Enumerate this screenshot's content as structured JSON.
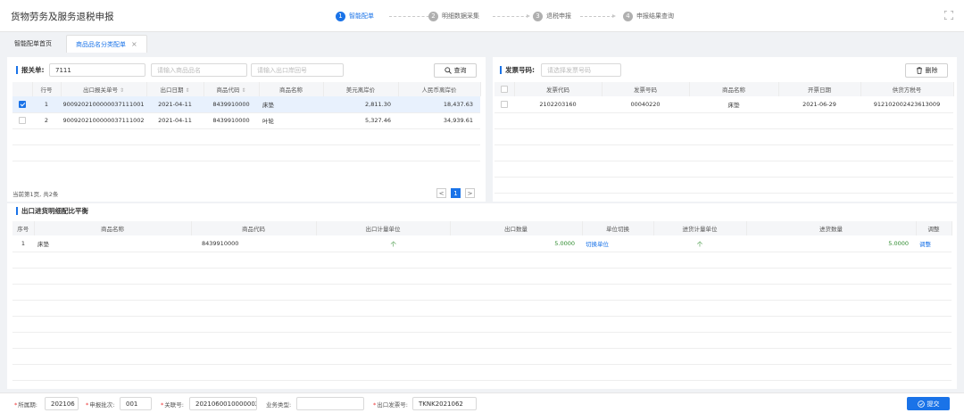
{
  "app": {
    "title": "货物劳务及服务退税申报"
  },
  "steps": [
    {
      "num": "1",
      "label": "智能配单"
    },
    {
      "num": "2",
      "label": "明细数据采集"
    },
    {
      "num": "3",
      "label": "退税申报"
    },
    {
      "num": "4",
      "label": "申报结果查询"
    }
  ],
  "tabs": {
    "home": "智能配单首页",
    "active": "商品品名分类配单",
    "close": "×"
  },
  "declaration": {
    "label": "报关单:",
    "value": "7111",
    "name_placeholder": "请输入商品品名",
    "port_placeholder": "请输入出口岸回号",
    "query_button": "查询",
    "columns": [
      "行号",
      "出口报关单号",
      "出口日期",
      "商品代码",
      "商品名称",
      "美元离岸价",
      "人民币离岸价"
    ],
    "rows": [
      {
        "checked": true,
        "line": "1",
        "no": "9009202100000037111001",
        "date": "2021-04-11",
        "code": "8439910000",
        "name": "床垫",
        "usd": "2,811.30",
        "cny": "18,437.63"
      },
      {
        "checked": false,
        "line": "2",
        "no": "9009202100000037111002",
        "date": "2021-04-11",
        "code": "8439910000",
        "name": "叶轮",
        "usd": "5,327.46",
        "cny": "34,939.61"
      }
    ],
    "pager_text": "当前第1页, 共2条",
    "pager_prev": "<",
    "pager_page": "1",
    "pager_next": ">"
  },
  "invoice": {
    "label": "发票号码:",
    "placeholder": "请选择发票号码",
    "delete_button": "删除",
    "columns": [
      "发票代码",
      "发票号码",
      "商品名称",
      "开票日期",
      "供货方税号"
    ],
    "rows": [
      {
        "checked": false,
        "code": "2102203160",
        "number": "00040220",
        "name": "床垫",
        "date": "2021-06-29",
        "tax_id": "912102002423613009"
      }
    ]
  },
  "balance": {
    "title": "出口进货明细配比平衡",
    "columns": [
      "序号",
      "商品名称",
      "商品代码",
      "出口计量单位",
      "出口数量",
      "单位切换",
      "进货计量单位",
      "进货数量",
      "调整"
    ],
    "rows": [
      {
        "seq": "1",
        "name": "床垫",
        "code": "8439910000",
        "export_unit": "个",
        "export_qty": "5.0000",
        "switch": "切换单位",
        "purchase_unit": "个",
        "purchase_qty": "5.0000",
        "adjust": "调整"
      }
    ]
  },
  "footer": {
    "period_label": "所属期:",
    "period_value": "202106",
    "batch_label": "申报批次:",
    "batch_value": "001",
    "link_label": "关联号:",
    "link_value": "20210600100000021",
    "biz_label": "业务类型:",
    "biz_value": "",
    "invoice_label": "出口发票号:",
    "invoice_value": "TKNK2021062",
    "submit": "提交"
  },
  "colors": {
    "accent": "#1a73e8",
    "green": "#2e8b2e"
  }
}
